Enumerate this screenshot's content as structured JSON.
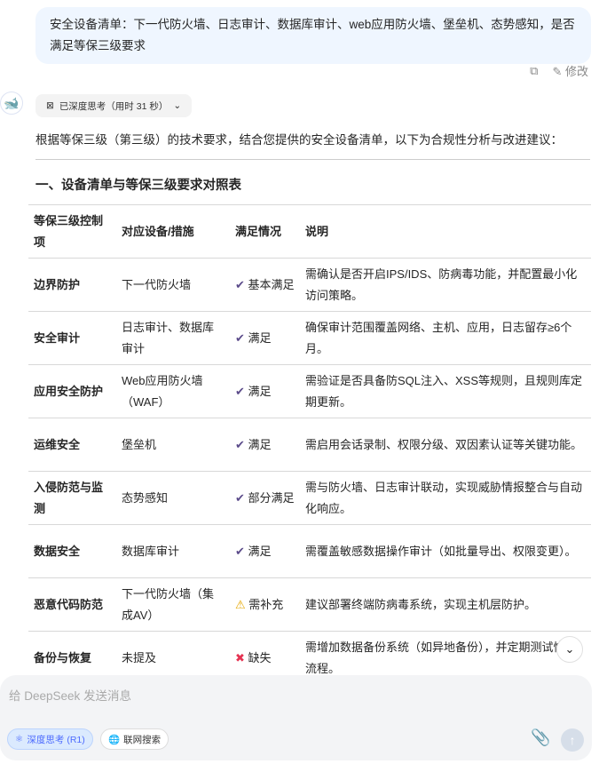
{
  "user_message": "安全设备清单：下一代防火墙、日志审计、数据库审计、web应用防火墙、堡垒机、态势感知，是否满足等保三级要求",
  "actions": {
    "edit_label": "修改"
  },
  "thinking": {
    "label": "已深度思考（用时 31 秒）"
  },
  "intro": "根据等保三级（第三级）的技术要求，结合您提供的安全设备清单，以下为合规性分析与改进建议：",
  "section_title": "一、设备清单与等保三级要求对照表",
  "table": {
    "headers": [
      "等保三级控制项",
      "对应设备/措施",
      "满足情况",
      "说明"
    ],
    "rows": [
      {
        "item": "边界防护",
        "device": "下一代防火墙",
        "status": "基本满足",
        "icon": "✔",
        "type": "ok",
        "note": "需确认是否开启IPS/IDS、防病毒功能，并配置最小化访问策略。"
      },
      {
        "item": "安全审计",
        "device": "日志审计、数据库审计",
        "status": "满足",
        "icon": "✔",
        "type": "ok",
        "note": "确保审计范围覆盖网络、主机、应用，日志留存≥6个月。"
      },
      {
        "item": "应用安全防护",
        "device": "Web应用防火墙（WAF）",
        "status": "满足",
        "icon": "✔",
        "type": "ok",
        "note": "需验证是否具备防SQL注入、XSS等规则，且规则库定期更新。"
      },
      {
        "item": "运维安全",
        "device": "堡垒机",
        "status": "满足",
        "icon": "✔",
        "type": "ok",
        "note": "需启用会话录制、权限分级、双因素认证等关键功能。"
      },
      {
        "item": "入侵防范与监测",
        "device": "态势感知",
        "status": "部分满足",
        "icon": "✔",
        "type": "ok",
        "note": "需与防火墙、日志审计联动，实现威胁情报整合与自动化响应。"
      },
      {
        "item": "数据安全",
        "device": "数据库审计",
        "status": "满足",
        "icon": "✔",
        "type": "ok",
        "note": "需覆盖敏感数据操作审计（如批量导出、权限变更）。"
      },
      {
        "item": "恶意代码防范",
        "device": "下一代防火墙（集成AV）",
        "status": "需补充",
        "icon": "⚠",
        "type": "warn",
        "note": "建议部署终端防病毒系统，实现主机层防护。"
      },
      {
        "item": "备份与恢复",
        "device": "未提及",
        "status": "缺失",
        "icon": "✖",
        "type": "no",
        "note": "需增加数据备份系统（如异地备份），并定期测试恢复流程。"
      }
    ]
  },
  "input": {
    "placeholder": "给 DeepSeek 发送消息",
    "deep_think": "深度思考 (R1)",
    "web_search": "联网搜索"
  }
}
